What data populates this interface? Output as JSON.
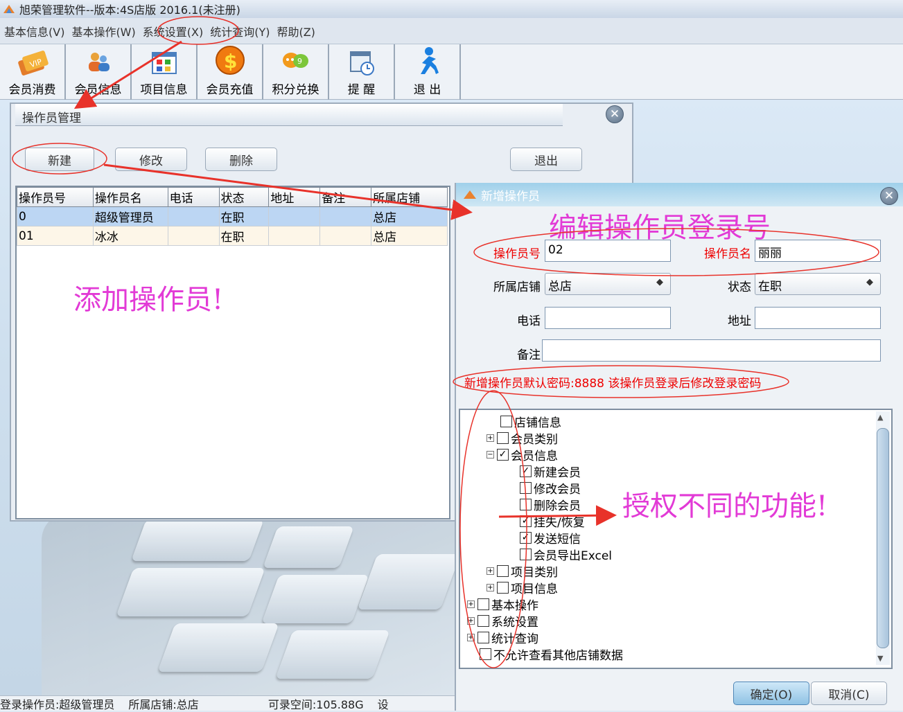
{
  "window": {
    "title": "旭荣管理软件--版本:4S店版 2016.1(未注册)"
  },
  "menu": {
    "items": [
      "基本信息(V)",
      "基本操作(W)",
      "系统设置(X)",
      "统计查询(Y)",
      "帮助(Z)"
    ]
  },
  "toolbar": {
    "buttons": [
      {
        "label": "会员消费",
        "icon": "vip-card-icon"
      },
      {
        "label": "会员信息",
        "icon": "users-icon"
      },
      {
        "label": "项目信息",
        "icon": "grid-icon"
      },
      {
        "label": "会员充值",
        "icon": "dollar-icon"
      },
      {
        "label": "积分兑换",
        "icon": "chat-bubbles-icon"
      },
      {
        "label": "提 醒",
        "icon": "clock-window-icon"
      },
      {
        "label": "退 出",
        "icon": "exit-person-icon"
      }
    ]
  },
  "operator_manager": {
    "title": "操作员管理",
    "buttons": {
      "new": "新建",
      "edit": "修改",
      "delete": "删除",
      "exit": "退出"
    },
    "columns": [
      "操作员号",
      "操作员名",
      "电话",
      "状态",
      "地址",
      "备注",
      "所属店铺"
    ],
    "rows": [
      [
        "0",
        "超级管理员",
        "",
        "在职",
        "",
        "",
        "总店"
      ],
      [
        "01",
        "冰冰",
        "",
        "在职",
        "",
        "",
        "总店"
      ]
    ]
  },
  "new_operator": {
    "title": "新增操作员",
    "labels": {
      "id": "操作员号",
      "name": "操作员名",
      "shop": "所属店铺",
      "status": "状态",
      "phone": "电话",
      "address": "地址",
      "remark": "备注"
    },
    "values": {
      "id": "02",
      "name": "丽丽",
      "shop": "总店",
      "status": "在职",
      "phone": "",
      "address": "",
      "remark": ""
    },
    "note": "新增操作员默认密码:8888 该操作员登录后修改登录密码",
    "tree": [
      {
        "label": "店铺信息",
        "checked": false
      },
      {
        "label": "会员类别",
        "checked": false
      },
      {
        "label": "会员信息",
        "checked": true
      },
      {
        "label": "新建会员",
        "checked": true
      },
      {
        "label": "修改会员",
        "checked": false
      },
      {
        "label": "删除会员",
        "checked": false
      },
      {
        "label": "挂失/恢复",
        "checked": true
      },
      {
        "label": "发送短信",
        "checked": true
      },
      {
        "label": "会员导出Excel",
        "checked": false
      },
      {
        "label": "项目类别",
        "checked": false
      },
      {
        "label": "项目信息",
        "checked": false
      },
      {
        "label": "基本操作",
        "checked": false
      },
      {
        "label": "系统设置",
        "checked": false
      },
      {
        "label": "统计查询",
        "checked": false
      },
      {
        "label": "不允许查看其他店铺数据",
        "checked": false
      }
    ],
    "ok": "确定(O)",
    "cancel": "取消(C)"
  },
  "annotations": {
    "add_operator": "添加操作员!",
    "edit_login": "编辑操作员登录号",
    "grant": "授权不同的功能!"
  },
  "status": {
    "operator": "登录操作员:超级管理员",
    "shop": "所属店铺:总店",
    "space": "可录空间:105.88G",
    "extra": "设"
  },
  "colors": {
    "annotation": "#e23ad6",
    "arrow": "#e8322a",
    "note": "#e00000"
  }
}
